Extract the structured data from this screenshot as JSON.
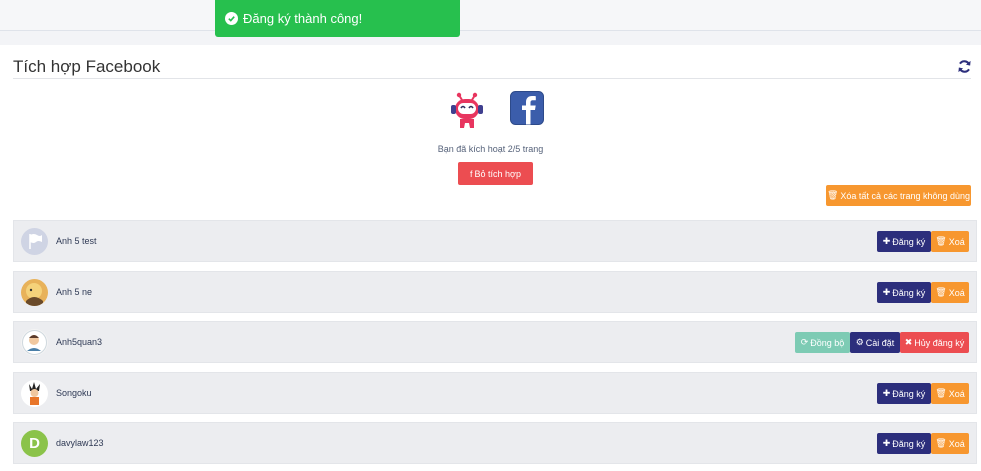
{
  "toast": {
    "message": "Đăng ký thành công!"
  },
  "panel": {
    "title": "Tích hợp Facebook",
    "activated_text": "Bạn đã kích hoạt 2/5 trang",
    "unintegrate_label": "Bỏ tích hợp",
    "delete_all_label": "Xóa tất cả các trang không dùng"
  },
  "pages": [
    {
      "name": "Anh 5 test",
      "avatar": "flag-placeholder",
      "actions": [
        "subscribe",
        "delete"
      ]
    },
    {
      "name": "Anh 5 ne",
      "avatar": "character-photo",
      "actions": [
        "subscribe",
        "delete"
      ]
    },
    {
      "name": "Anh5quan3",
      "avatar": "cartoon-photo",
      "actions": [
        "sync",
        "settings",
        "unsubscribe"
      ]
    },
    {
      "name": "Songoku",
      "avatar": "goku-photo",
      "actions": [
        "subscribe",
        "delete"
      ]
    },
    {
      "name": "davylaw123",
      "avatar": "letter-d",
      "avatar_letter": "D",
      "actions": [
        "subscribe",
        "delete"
      ]
    }
  ],
  "labels": {
    "subscribe": "Đăng ký",
    "delete": "Xoá",
    "sync": "Đồng bộ",
    "settings": "Cài đặt",
    "unsubscribe": "Hủy đăng ký"
  },
  "colors": {
    "success": "#27c04e",
    "danger": "#ec4d51",
    "warning": "#f7972f",
    "primary": "#2c2e7c",
    "sync": "#7dcbb4"
  }
}
